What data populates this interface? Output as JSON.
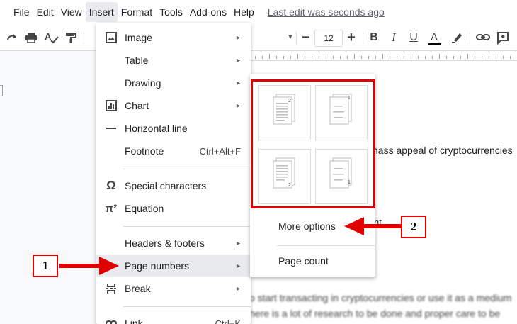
{
  "menubar": {
    "items": [
      "File",
      "Edit",
      "View",
      "Insert",
      "Format",
      "Tools",
      "Add-ons",
      "Help"
    ],
    "last_edit": "Last edit was seconds ago"
  },
  "toolbar": {
    "font_size": "12",
    "font_name_fragment": "i"
  },
  "insert_menu": {
    "items": [
      {
        "label": "Image",
        "icon": "image-icon",
        "submenu": true
      },
      {
        "label": "Table",
        "icon": "",
        "submenu": true
      },
      {
        "label": "Drawing",
        "icon": "",
        "submenu": true
      },
      {
        "label": "Chart",
        "icon": "chart-icon",
        "submenu": true
      },
      {
        "label": "Horizontal line",
        "icon": "horizontal-line-icon",
        "submenu": false
      },
      {
        "label": "Footnote",
        "icon": "",
        "shortcut": "Ctrl+Alt+F"
      },
      {
        "label": "Special characters",
        "icon": "omega-icon",
        "submenu": false
      },
      {
        "label": "Equation",
        "icon": "pi-icon",
        "icon_text": "π²",
        "submenu": false
      },
      {
        "label": "Headers & footers",
        "icon": "",
        "submenu": true
      },
      {
        "label": "Page numbers",
        "icon": "",
        "submenu": true
      },
      {
        "label": "Break",
        "icon": "break-icon",
        "submenu": true
      },
      {
        "label": "Link",
        "icon": "link-icon",
        "shortcut": "Ctrl+K"
      }
    ],
    "arrow_glyph": "►"
  },
  "page_numbers_submenu": {
    "options": [
      {
        "name": "header-all-pages",
        "number_shown": "2"
      },
      {
        "name": "header-skip-first",
        "number_shown": "1"
      },
      {
        "name": "footer-all-pages",
        "number_shown": "2"
      },
      {
        "name": "footer-skip-first",
        "number_shown": "1"
      }
    ],
    "more_options": "More options",
    "page_count": "Page count"
  },
  "document": {
    "line_visible": "nass appeal of cryptocurrencies",
    "line_fragment": "nt",
    "blurred_line_1": "o start transacting in cryptocurrencies or use it as a medium",
    "blurred_line_2": "here is a lot of research to be done and proper care to be"
  },
  "callouts": {
    "step1": "1",
    "step2": "2"
  },
  "colors": {
    "annotation_red": "#e00000",
    "menu_hover": "#e8eaed"
  }
}
